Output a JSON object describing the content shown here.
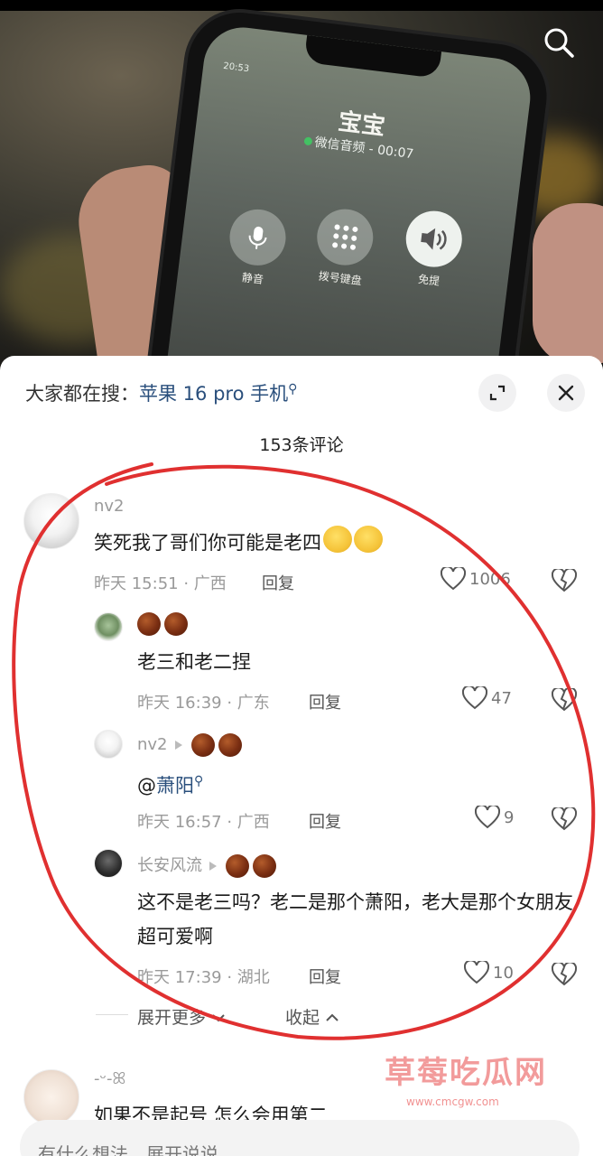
{
  "video": {
    "phone_screen": {
      "caller_name": "宝宝",
      "call_status": "微信音频 - 00:07",
      "buttons": [
        {
          "label": "静音",
          "icon": "microphone-icon"
        },
        {
          "label": "拨号键盘",
          "icon": "keypad-icon"
        },
        {
          "label": "免提",
          "icon": "speaker-icon"
        }
      ]
    },
    "search_icon": "search-icon"
  },
  "sheet": {
    "hot_search_prefix": "大家都在搜：",
    "hot_search_keyword": "苹果 16 pro 手机",
    "comment_count": "153条评论",
    "comments": [
      {
        "user": "nv2",
        "text": "笑死我了哥们你可能是老四",
        "time": "昨天 15:51 · 广西",
        "reply_label": "回复",
        "likes": "1006",
        "replies": [
          {
            "user": "",
            "text": "老三和老二捏",
            "time": "昨天 16:39 · 广东",
            "reply_label": "回复",
            "likes": "47"
          },
          {
            "user": "nv2",
            "text_prefix": "@",
            "mention": "萧阳",
            "time": "昨天 16:57 · 广西",
            "reply_label": "回复",
            "likes": "9"
          },
          {
            "user": "长安风流",
            "text": "这不是老三吗？老二是那个萧阳，老大是那个女朋友超可爱啊",
            "time": "昨天 17:39 · 湖北",
            "reply_label": "回复",
            "likes": "10"
          }
        ],
        "expand_more": "展开更多",
        "collapse": "收起"
      },
      {
        "user": "-ᵕ-ꕤ",
        "text": "如果不是起号 怎么会用第二"
      }
    ],
    "input_placeholder": "有什么想法，展开说说"
  },
  "watermark": {
    "text": "草莓吃瓜网",
    "url": "www.cmcgw.com"
  },
  "colors": {
    "accent_link": "#2a4f7c",
    "annotation_red": "#e03030"
  }
}
